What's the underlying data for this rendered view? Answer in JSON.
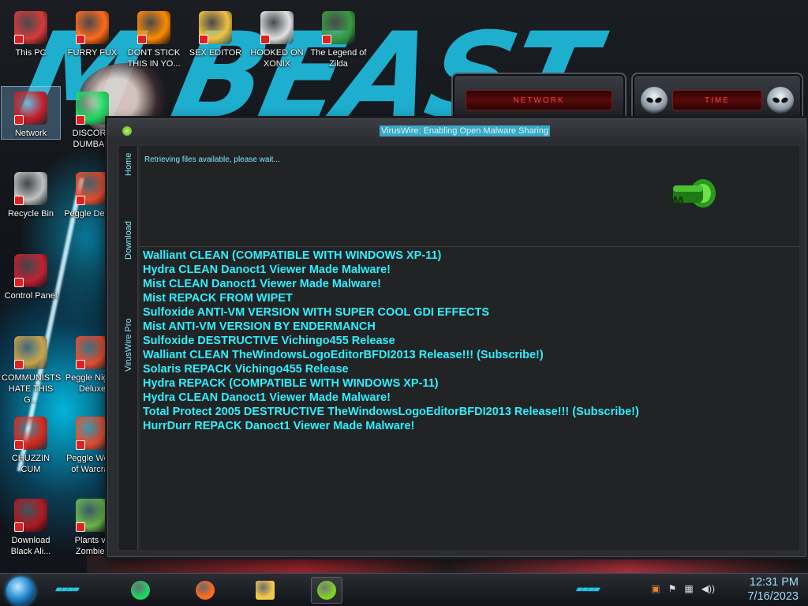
{
  "desktop": {
    "icons": [
      {
        "label": "This PC",
        "icon": "computer-icon",
        "color": "#d63a3a"
      },
      {
        "label": "FURRY FUX",
        "icon": "firefox-icon",
        "color": "#ff6a1a"
      },
      {
        "label": "DONT STICK THIS IN YO...",
        "icon": "vlc-cone-icon",
        "color": "#ff8a00"
      },
      {
        "label": "SEX EDITOR",
        "icon": "hex-editor-icon",
        "color": "#f0c040"
      },
      {
        "label": "HOOKED ON XONIX",
        "icon": "xonix-game-icon",
        "color": "#e0e0e0"
      },
      {
        "label": "The Legend of Zilda",
        "icon": "pixel-hero-icon",
        "color": "#3a9a40"
      },
      {
        "label": "Network",
        "icon": "network-globe-icon",
        "color": "#c61d2a"
      },
      {
        "label": "DISCORD DUMBA...",
        "icon": "spotify-like-icon",
        "color": "#1ed760"
      },
      {
        "label": "Recycle Bin",
        "icon": "recycle-bin-icon",
        "color": "#c0c0c0"
      },
      {
        "label": "Peggle Deluxe",
        "icon": "peggle-icon",
        "color": "#e84c2c"
      },
      {
        "label": "Control Panel",
        "icon": "control-panel-icon",
        "color": "#c02030"
      },
      {
        "label": "COMMUNISTS HATE THIS G...",
        "icon": "money-bag-icon",
        "color": "#c9a24a"
      },
      {
        "label": "Peggle Nights Deluxe",
        "icon": "peggle-icon",
        "color": "#e84c2c"
      },
      {
        "label": "CHUZZIN CUM",
        "icon": "chuzzle-icon",
        "color": "#d8261a"
      },
      {
        "label": "Peggle World of Warcraft",
        "icon": "peggle-icon",
        "color": "#e84c2c"
      },
      {
        "label": "Download Black Ali...",
        "icon": "alien-theme-icon",
        "color": "#b01820"
      },
      {
        "label": "Plants vs Zombies",
        "icon": "pvz-flower-icon",
        "color": "#6ab84a"
      }
    ]
  },
  "widgets": {
    "network_label": "NETWORK",
    "time_label": "TIME"
  },
  "window": {
    "title": "VirusWire: Enabling Open Malware Sharing",
    "tabs": [
      "Home",
      "Download",
      "VirusWire Pro"
    ],
    "status": "Retrieving files available, please wait...",
    "files": [
      "Walliant CLEAN (COMPATIBLE WITH WINDOWS XP-11)",
      "Hydra CLEAN Danoct1 Viewer Made Malware!",
      "Mist CLEAN Danoct1 Viewer Made Malware!",
      "Mist REPACK FROM WIPET",
      "Sulfoxide ANTI-VM VERSION WITH SUPER COOL GDI EFFECTS",
      "Mist ANTI-VM VERSION BY ENDERMANCH",
      "Sulfoxide DESTRUCTIVE Vichingo455 Release",
      "Walliant CLEAN TheWindowsLogoEditorBFDI2013 Release!!! (Subscribe!)",
      "Solaris REPACK Vichingo455 Release",
      "Hydra REPACK (COMPATIBLE WITH WINDOWS XP-11)",
      "Hydra CLEAN Danoct1 Viewer Made Malware!",
      "Total Protect 2005 DESTRUCTIVE TheWindowsLogoEditorBFDI2013 Release!!! (Subscribe!)",
      "HurrDurr REPACK Danoct1 Viewer Made Malware!"
    ],
    "accent": "#2ef0ff"
  },
  "taskbar": {
    "apps": [
      {
        "icon": "spotify-like-icon",
        "active": false
      },
      {
        "icon": "firefox-icon",
        "active": false
      },
      {
        "icon": "file-explorer-icon",
        "active": false
      },
      {
        "icon": "limewire-icon",
        "active": true
      }
    ],
    "time": "12:31 PM",
    "date": "7/16/2023"
  }
}
